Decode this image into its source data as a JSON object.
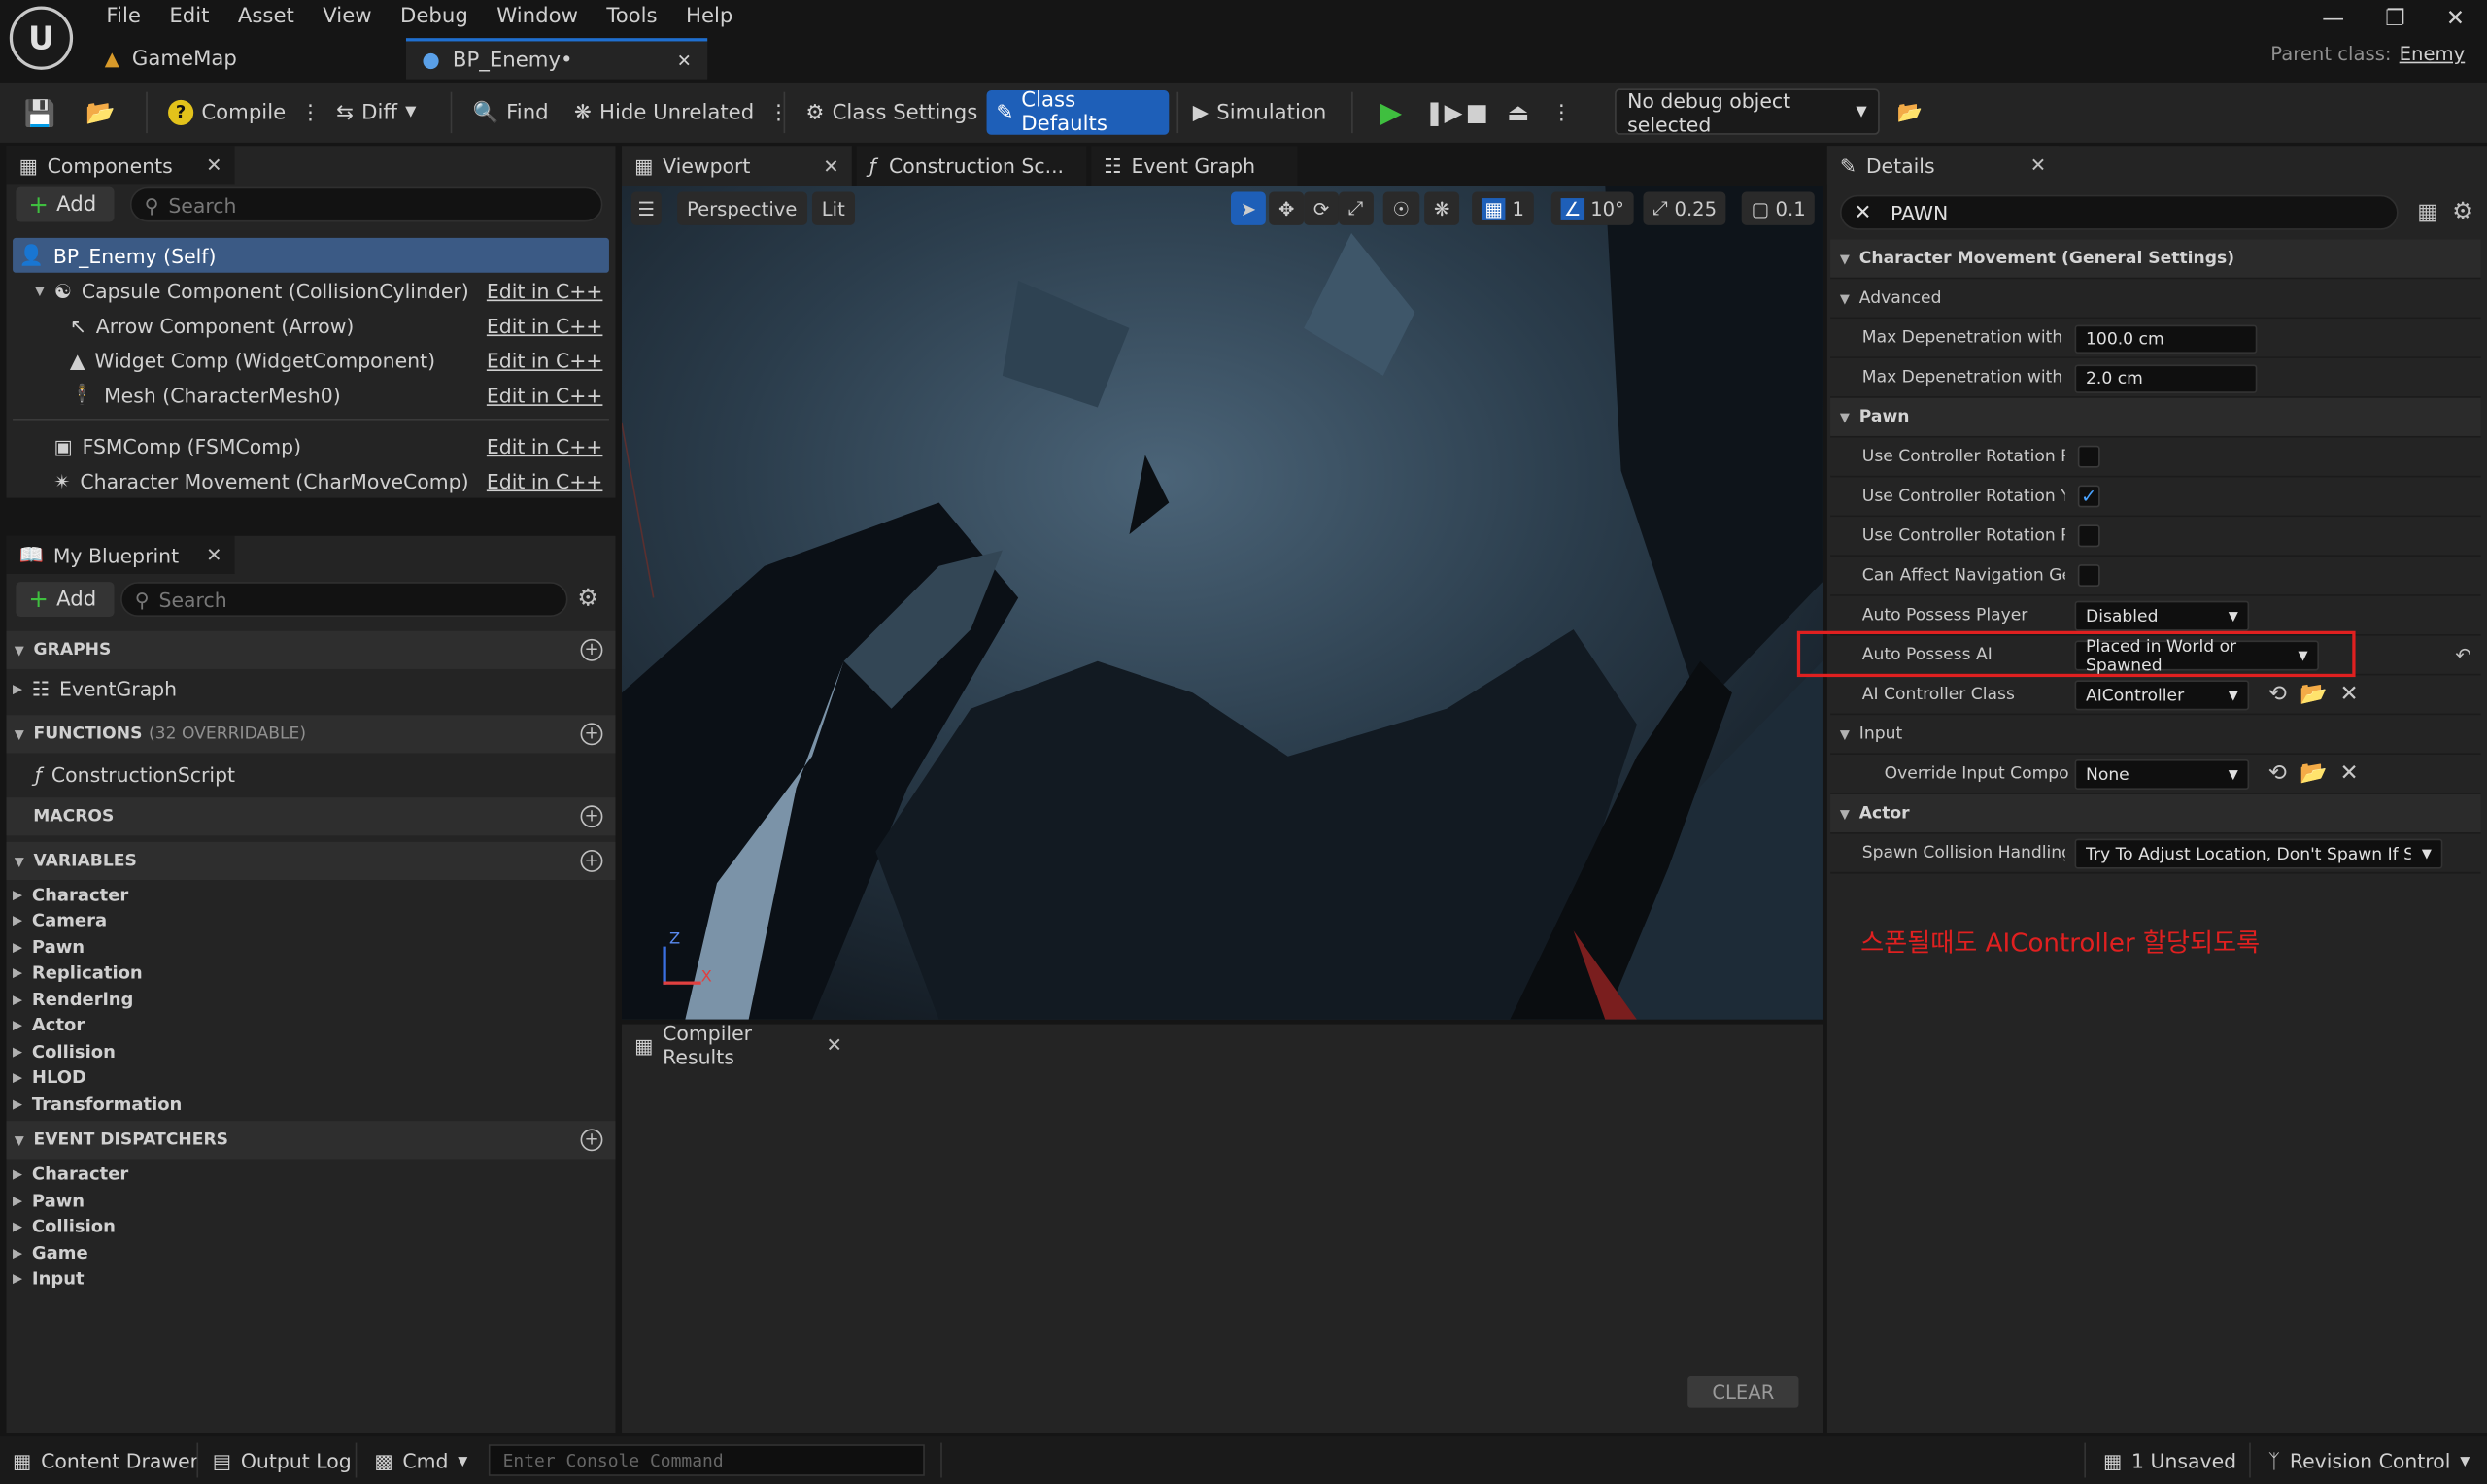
{
  "menu": [
    "File",
    "Edit",
    "Asset",
    "View",
    "Debug",
    "Window",
    "Tools",
    "Help"
  ],
  "tabs": {
    "map": "GameMap",
    "blueprint": "BP_Enemy•"
  },
  "parent_class": {
    "label": "Parent class:",
    "value": "Enemy"
  },
  "toolbar": {
    "compile": "Compile",
    "diff": "Diff",
    "find": "Find",
    "hide_unrelated": "Hide Unrelated",
    "class_settings": "Class Settings",
    "class_defaults": "Class Defaults",
    "simulation": "Simulation",
    "debug_object": "No debug object selected"
  },
  "components": {
    "title": "Components",
    "add": "Add",
    "search_placeholder": "Search",
    "root": "BP_Enemy (Self)",
    "edit_label": "Edit in C++",
    "items": [
      "Capsule Component (CollisionCylinder)",
      "Arrow Component (Arrow)",
      "Widget Comp (WidgetComponent)",
      "Mesh (CharacterMesh0)",
      "FSMComp (FSMComp)",
      "Character Movement (CharMoveComp)"
    ]
  },
  "my_blueprint": {
    "title": "My Blueprint",
    "add": "Add",
    "search_placeholder": "Search",
    "graphs": "GRAPHS",
    "event_graph": "EventGraph",
    "functions": "FUNCTIONS",
    "functions_note": "(32 OVERRIDABLE)",
    "construction_script": "ConstructionScript",
    "macros": "MACROS",
    "variables": "VARIABLES",
    "variable_categories": [
      "Character",
      "Camera",
      "Pawn",
      "Replication",
      "Rendering",
      "Actor",
      "Collision",
      "HLOD",
      "Transformation"
    ],
    "event_dispatchers": "EVENT DISPATCHERS",
    "dispatcher_categories": [
      "Character",
      "Pawn",
      "Collision",
      "Game",
      "Input"
    ]
  },
  "viewport_tabs": {
    "viewport": "Viewport",
    "construction": "Construction Sc...",
    "event_graph": "Event Graph"
  },
  "viewport": {
    "perspective": "Perspective",
    "lit": "Lit",
    "grid": "1",
    "angle": "10°",
    "scale": "0.25",
    "camera": "0.1",
    "axis_z": "Z",
    "axis_x": "X"
  },
  "compiler": {
    "title": "Compiler Results",
    "clear": "CLEAR"
  },
  "details": {
    "title": "Details",
    "search_value": "PAWN",
    "section_char_move": "Character Movement (General Settings)",
    "advanced": "Advanced",
    "max_dep_1_label": "Max Depenetration with P...",
    "max_dep_1_value": "100.0 cm",
    "max_dep_2_label": "Max Depenetration with P...",
    "max_dep_2_value": "2.0 cm",
    "section_pawn": "Pawn",
    "use_ctrl_pitch": "Use Controller Rotation Pi...",
    "use_ctrl_yaw": "Use Controller Rotation Yaw",
    "use_ctrl_roll": "Use Controller Rotation Roll",
    "can_affect_nav": "Can Affect Navigation Gen...",
    "auto_possess_player": "Auto Possess Player",
    "auto_possess_player_value": "Disabled",
    "auto_possess_ai": "Auto Possess AI",
    "auto_possess_ai_value": "Placed in World or Spawned",
    "ai_controller_class": "AI Controller Class",
    "ai_controller_class_value": "AIController",
    "section_input": "Input",
    "override_input": "Override Input Compo...",
    "override_input_value": "None",
    "section_actor": "Actor",
    "spawn_collision": "Spawn Collision Handling...",
    "spawn_collision_value": "Try To Adjust Location, Don't Spawn If Still Co",
    "annotation": "스폰될때도 AIController 할당되도록",
    "checked_yaw": true
  },
  "statusbar": {
    "content_drawer": "Content Drawer",
    "output_log": "Output Log",
    "cmd": "Cmd",
    "console_placeholder": "Enter Console Command",
    "unsaved": "1 Unsaved",
    "revision_control": "Revision Control"
  },
  "colors": {
    "accent": "#1e5fb8",
    "annotation": "#e02020",
    "play": "#3fbf3f"
  }
}
